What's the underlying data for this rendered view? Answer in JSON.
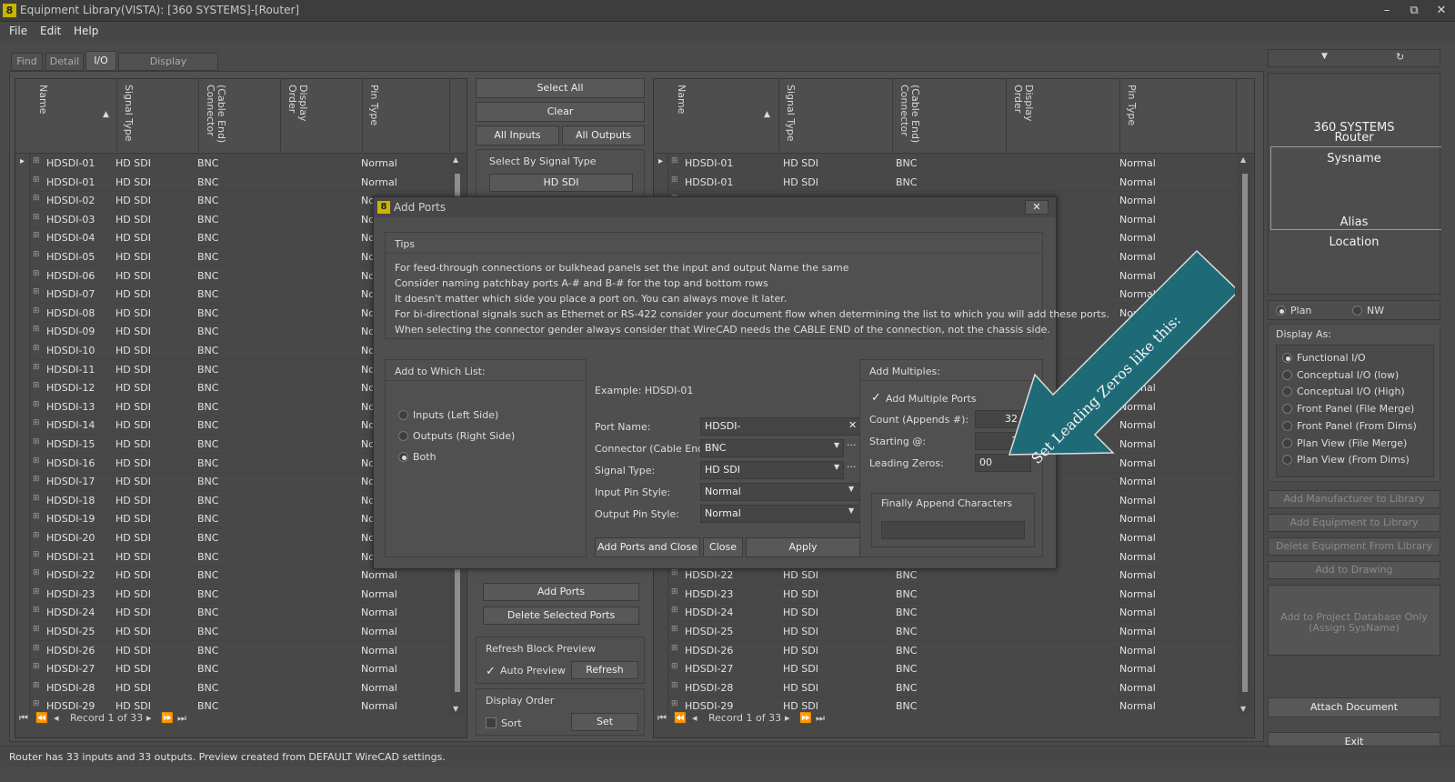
{
  "window": {
    "title": "Equipment Library(VISTA): [360 SYSTEMS]-[Router]",
    "app_icon": "8",
    "min": "–",
    "restore": "⧉",
    "close": "✕"
  },
  "menu": [
    "File",
    "Edit",
    "Help"
  ],
  "tabs": [
    "Find",
    "Detail",
    "I/O",
    "Display Preferences"
  ],
  "left_grid": {
    "headers": [
      "Name",
      "Signal Type",
      "(Cable End) Connector",
      "Display Order",
      "Pin Type"
    ],
    "rows": [
      [
        "HDSDI-01",
        "HD SDI",
        "BNC",
        "Normal"
      ],
      [
        "HDSDI-01",
        "HD SDI",
        "BNC",
        "Normal"
      ],
      [
        "HDSDI-02",
        "HD SDI",
        "BNC",
        "No"
      ],
      [
        "HDSDI-03",
        "HD SDI",
        "BNC",
        "No"
      ],
      [
        "HDSDI-04",
        "HD SDI",
        "BNC",
        "No"
      ],
      [
        "HDSDI-05",
        "HD SDI",
        "BNC",
        "No"
      ],
      [
        "HDSDI-06",
        "HD SDI",
        "BNC",
        "No"
      ],
      [
        "HDSDI-07",
        "HD SDI",
        "BNC",
        "No"
      ],
      [
        "HDSDI-08",
        "HD SDI",
        "BNC",
        "No"
      ],
      [
        "HDSDI-09",
        "HD SDI",
        "BNC",
        "No"
      ],
      [
        "HDSDI-10",
        "HD SDI",
        "BNC",
        "No"
      ],
      [
        "HDSDI-11",
        "HD SDI",
        "BNC",
        "No"
      ],
      [
        "HDSDI-12",
        "HD SDI",
        "BNC",
        "No"
      ],
      [
        "HDSDI-13",
        "HD SDI",
        "BNC",
        "No"
      ],
      [
        "HDSDI-14",
        "HD SDI",
        "BNC",
        "No"
      ],
      [
        "HDSDI-15",
        "HD SDI",
        "BNC",
        "No"
      ],
      [
        "HDSDI-16",
        "HD SDI",
        "BNC",
        "No"
      ],
      [
        "HDSDI-17",
        "HD SDI",
        "BNC",
        "No"
      ],
      [
        "HDSDI-18",
        "HD SDI",
        "BNC",
        "No"
      ],
      [
        "HDSDI-19",
        "HD SDI",
        "BNC",
        "No"
      ],
      [
        "HDSDI-20",
        "HD SDI",
        "BNC",
        "No"
      ],
      [
        "HDSDI-21",
        "HD SDI",
        "BNC",
        "No"
      ],
      [
        "HDSDI-22",
        "HD SDI",
        "BNC",
        "Normal"
      ],
      [
        "HDSDI-23",
        "HD SDI",
        "BNC",
        "Normal"
      ],
      [
        "HDSDI-24",
        "HD SDI",
        "BNC",
        "Normal"
      ],
      [
        "HDSDI-25",
        "HD SDI",
        "BNC",
        "Normal"
      ],
      [
        "HDSDI-26",
        "HD SDI",
        "BNC",
        "Normal"
      ],
      [
        "HDSDI-27",
        "HD SDI",
        "BNC",
        "Normal"
      ],
      [
        "HDSDI-28",
        "HD SDI",
        "BNC",
        "Normal"
      ],
      [
        "HDSDI-29",
        "HD SDI",
        "BNC",
        "Normal"
      ]
    ],
    "record": "Record 1 of 33"
  },
  "right_grid": {
    "headers": [
      "Name",
      "Signal Type",
      "(Cable End) Connector",
      "Display Order",
      "Pin Type"
    ],
    "rows": [
      [
        "HDSDI-01",
        "HD SDI",
        "BNC",
        "Normal"
      ],
      [
        "HDSDI-01",
        "HD SDI",
        "BNC",
        "Normal"
      ],
      [
        "",
        "",
        "",
        "Normal"
      ],
      [
        "",
        "",
        "",
        "Normal"
      ],
      [
        "",
        "",
        "",
        "Normal"
      ],
      [
        "",
        "",
        "",
        "Normal"
      ],
      [
        "",
        "",
        "",
        "Normal"
      ],
      [
        "",
        "",
        "",
        "Normal"
      ],
      [
        "",
        "",
        "",
        "Normal"
      ],
      [
        "",
        "",
        "",
        "Normal"
      ],
      [
        "",
        "",
        "",
        "Normal"
      ],
      [
        "",
        "",
        "",
        "Normal"
      ],
      [
        "",
        "",
        "",
        "Normal"
      ],
      [
        "",
        "",
        "",
        "Normal"
      ],
      [
        "",
        "",
        "",
        "Normal"
      ],
      [
        "",
        "",
        "",
        "Normal"
      ],
      [
        "",
        "",
        "",
        "Normal"
      ],
      [
        "",
        "",
        "",
        "Normal"
      ],
      [
        "",
        "",
        "",
        "Normal"
      ],
      [
        "",
        "",
        "",
        "Normal"
      ],
      [
        "",
        "",
        "",
        "Normal"
      ],
      [
        "",
        "",
        "",
        "Normal"
      ],
      [
        "HDSDI-22",
        "HD SDI",
        "BNC",
        "Normal"
      ],
      [
        "HDSDI-23",
        "HD SDI",
        "BNC",
        "Normal"
      ],
      [
        "HDSDI-24",
        "HD SDI",
        "BNC",
        "Normal"
      ],
      [
        "HDSDI-25",
        "HD SDI",
        "BNC",
        "Normal"
      ],
      [
        "HDSDI-26",
        "HD SDI",
        "BNC",
        "Normal"
      ],
      [
        "HDSDI-27",
        "HD SDI",
        "BNC",
        "Normal"
      ],
      [
        "HDSDI-28",
        "HD SDI",
        "BNC",
        "Normal"
      ],
      [
        "HDSDI-29",
        "HD SDI",
        "BNC",
        "Normal"
      ]
    ],
    "record": "Record 1 of 33"
  },
  "middle": {
    "select_all": "Select All",
    "clear": "Clear",
    "all_inputs": "All Inputs",
    "all_outputs": "All Outputs",
    "select_by_signal": "Select By Signal Type",
    "signal_hd_sdi": "HD SDI",
    "add_ports": "Add Ports",
    "delete_selected": "Delete Selected Ports",
    "refresh_block": "Refresh Block Preview",
    "auto_preview": "Auto Preview",
    "refresh": "Refresh",
    "display_order": "Display Order",
    "sort": "Sort",
    "set": "Set"
  },
  "side": {
    "company": "360 SYSTEMS",
    "model": "Router",
    "sysname": "Sysname",
    "alias": "Alias",
    "location": "Location",
    "plan": "Plan",
    "nw": "NW",
    "display_as": "Display As:",
    "display_options": [
      "Functional I/O",
      "Conceptual I/O (low)",
      "Conceptual I/O (High)",
      "Front Panel (File Merge)",
      "Front Panel (From Dims)",
      "Plan View (File Merge)",
      "Plan View (From Dims)"
    ],
    "add_manufacturer": "Add Manufacturer to Library",
    "add_equipment": "Add Equipment to Library",
    "delete_equipment": "Delete Equipment From Library",
    "add_drawing": "Add to Drawing",
    "add_project_1": "Add to Project Database Only",
    "add_project_2": "(Assign SysName)",
    "attach": "Attach Document",
    "exit": "Exit"
  },
  "dialog": {
    "title": "Add Ports",
    "tips_label": "Tips",
    "tips": [
      "For feed-through connections or bulkhead panels set the input and output Name the same",
      "Consider naming patchbay ports A-# and B-# for the top and bottom rows",
      "It doesn't matter which side you place a port on. You can always move it later.",
      "For bi-directional signals such as Ethernet or RS-422 consider your document flow when determining the list to which you will add these ports.",
      "When selecting the connector gender always consider that WireCAD needs the CABLE END of the connection, not the chassis side."
    ],
    "add_to_list": "Add to Which List:",
    "inputs": "Inputs (Left Side)",
    "outputs": "Outputs (Right Side)",
    "both": "Both",
    "example": "Example: HDSDI-01",
    "port_name_label": "Port Name:",
    "port_name": "HDSDI-",
    "connector_label": "Connector (Cable End):",
    "connector": "BNC",
    "signal_label": "Signal Type:",
    "signal": "HD SDI",
    "input_pin_label": "Input Pin Style:",
    "input_pin": "Normal",
    "output_pin_label": "Output Pin Style:",
    "output_pin": "Normal",
    "add_multiples": "Add Multiples:",
    "add_multiple_ports": "Add Multiple Ports",
    "count_label": "Count (Appends #):",
    "count": "32",
    "starting_label": "Starting @:",
    "starting": "1",
    "leading_label": "Leading Zeros:",
    "leading": "00",
    "finally_append": "Finally Append Characters",
    "append_value": "",
    "add_close": "Add Ports and Close",
    "close": "Close",
    "apply": "Apply"
  },
  "annotation": "Set Leading Zeros like this:",
  "status": "Router has 33 inputs and 33 outputs. Preview created from DEFAULT WireCAD settings."
}
